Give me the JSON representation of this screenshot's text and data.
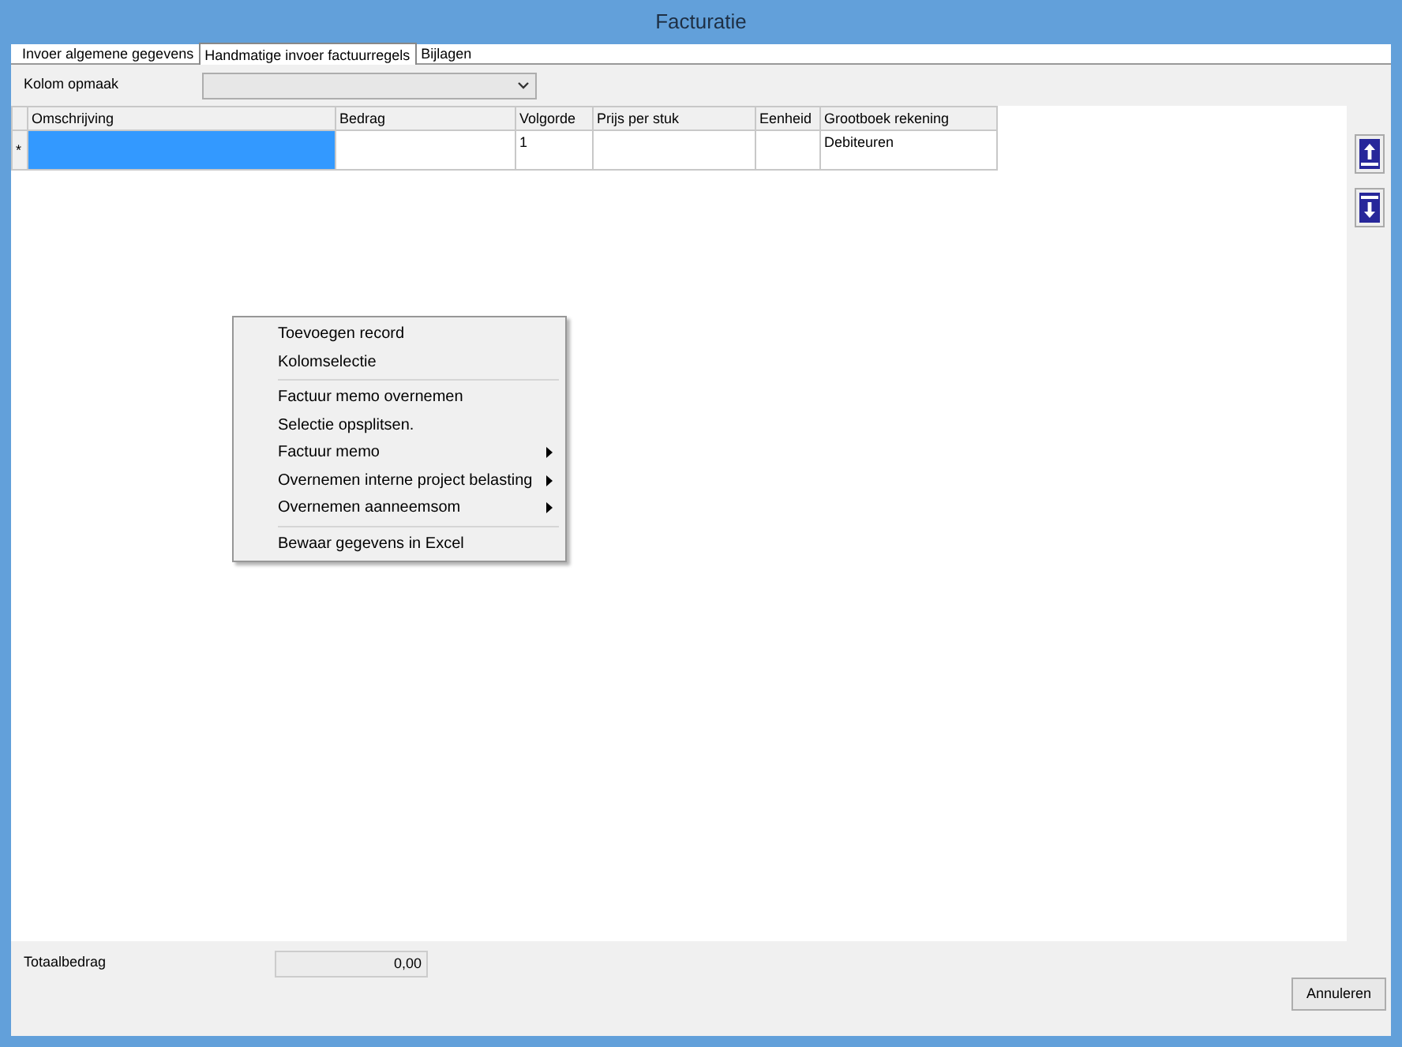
{
  "window": {
    "title": "Facturatie"
  },
  "tabs": [
    {
      "label": "Invoer algemene gegevens",
      "selected": false
    },
    {
      "label": "Handmatige invoer factuurregels",
      "selected": true
    },
    {
      "label": "Bijlagen",
      "selected": false
    }
  ],
  "layout_field": {
    "label": "Kolom opmaak"
  },
  "table": {
    "columns": [
      "Omschrijving",
      "Bedrag",
      "Volgorde",
      "Prijs per stuk",
      "Eenheid",
      "Grootboek rekening"
    ],
    "rows": [
      {
        "marker": "*",
        "cells": [
          {
            "selected": true
          },
          {
            "selected": false
          },
          {
            "value": "1",
            "selected": false
          },
          {
            "selected": false
          },
          {
            "selected": false
          },
          {
            "value": "Debiteuren",
            "selected": false
          }
        ]
      }
    ]
  },
  "side_buttons": [
    {
      "kind": "up"
    },
    {
      "kind": "down"
    }
  ],
  "context_menu": [
    {
      "kind": "item",
      "label": "Toevoegen record",
      "submenu": false
    },
    {
      "kind": "item",
      "label": "Kolomselectie",
      "submenu": false
    },
    {
      "kind": "separator"
    },
    {
      "kind": "item",
      "label": "Factuur memo overnemen",
      "submenu": false
    },
    {
      "kind": "item",
      "label": "Selectie opsplitsen.",
      "submenu": false
    },
    {
      "kind": "item",
      "label": "Factuur memo",
      "submenu": true
    },
    {
      "kind": "item",
      "label": "Overnemen interne project belasting",
      "submenu": true
    },
    {
      "kind": "item",
      "label": "Overnemen aanneemsom",
      "submenu": true
    },
    {
      "kind": "separator"
    },
    {
      "kind": "item",
      "label": "Bewaar gegevens in Excel",
      "submenu": false
    }
  ],
  "total": {
    "label": "Totaalbedrag",
    "value": "0,00"
  },
  "buttons": [
    "Annuleren"
  ]
}
